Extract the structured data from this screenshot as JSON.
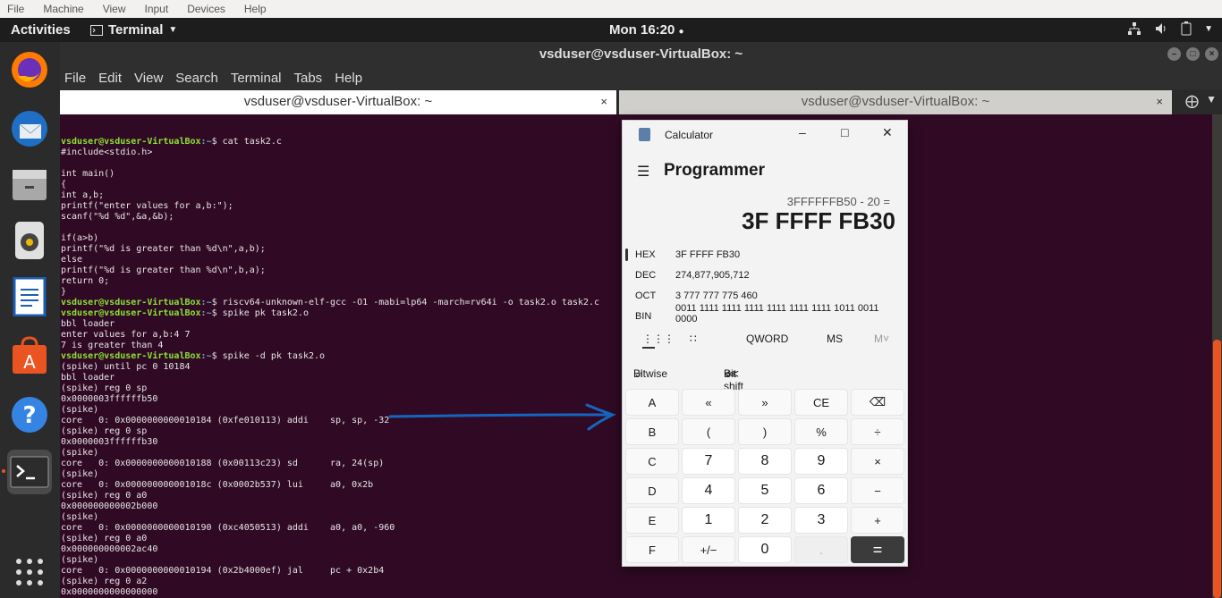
{
  "vbox_menu": [
    "File",
    "Machine",
    "View",
    "Input",
    "Devices",
    "Help"
  ],
  "topbar": {
    "activities": "Activities",
    "app_name": "Terminal",
    "clock": "Mon 16:20"
  },
  "terminal": {
    "window_title": "vsduser@vsduser-VirtualBox: ~",
    "menu": [
      "File",
      "Edit",
      "View",
      "Search",
      "Terminal",
      "Tabs",
      "Help"
    ],
    "tabs": [
      {
        "title": "vsduser@vsduser-VirtualBox: ~",
        "active": true
      },
      {
        "title": "vsduser@vsduser-VirtualBox: ~",
        "active": false
      }
    ],
    "prompt_user": "vsduser@vsduser-VirtualBox",
    "prompt_path": ":~",
    "lines": [
      {
        "prompt": true,
        "text": "$ cat task2.c"
      },
      {
        "prompt": false,
        "text": "#include<stdio.h>"
      },
      {
        "prompt": false,
        "text": ""
      },
      {
        "prompt": false,
        "text": "int main()"
      },
      {
        "prompt": false,
        "text": "{"
      },
      {
        "prompt": false,
        "text": "int a,b;"
      },
      {
        "prompt": false,
        "text": "printf(\"enter values for a,b:\");"
      },
      {
        "prompt": false,
        "text": "scanf(\"%d %d\",&a,&b);"
      },
      {
        "prompt": false,
        "text": ""
      },
      {
        "prompt": false,
        "text": "if(a>b)"
      },
      {
        "prompt": false,
        "text": "printf(\"%d is greater than %d\\n\",a,b);"
      },
      {
        "prompt": false,
        "text": "else"
      },
      {
        "prompt": false,
        "text": "printf(\"%d is greater than %d\\n\",b,a);"
      },
      {
        "prompt": false,
        "text": "return 0;"
      },
      {
        "prompt": false,
        "text": "}"
      },
      {
        "prompt": true,
        "text": "$ riscv64-unknown-elf-gcc -O1 -mabi=lp64 -march=rv64i -o task2.o task2.c"
      },
      {
        "prompt": true,
        "text": "$ spike pk task2.o"
      },
      {
        "prompt": false,
        "text": "bbl loader"
      },
      {
        "prompt": false,
        "text": "enter values for a,b:4 7"
      },
      {
        "prompt": false,
        "text": "7 is greater than 4"
      },
      {
        "prompt": true,
        "text": "$ spike -d pk task2.o"
      },
      {
        "prompt": false,
        "text": "(spike) until pc 0 10184"
      },
      {
        "prompt": false,
        "text": "bbl loader"
      },
      {
        "prompt": false,
        "text": "(spike) reg 0 sp"
      },
      {
        "prompt": false,
        "text": "0x0000003ffffffb50"
      },
      {
        "prompt": false,
        "text": "(spike)"
      },
      {
        "prompt": false,
        "text": "core   0: 0x0000000000010184 (0xfe010113) addi    sp, sp, -32"
      },
      {
        "prompt": false,
        "text": "(spike) reg 0 sp"
      },
      {
        "prompt": false,
        "text": "0x0000003ffffffb30"
      },
      {
        "prompt": false,
        "text": "(spike)"
      },
      {
        "prompt": false,
        "text": "core   0: 0x0000000000010188 (0x00113c23) sd      ra, 24(sp)"
      },
      {
        "prompt": false,
        "text": "(spike)"
      },
      {
        "prompt": false,
        "text": "core   0: 0x000000000001018c (0x0002b537) lui     a0, 0x2b"
      },
      {
        "prompt": false,
        "text": "(spike) reg 0 a0"
      },
      {
        "prompt": false,
        "text": "0x000000000002b000"
      },
      {
        "prompt": false,
        "text": "(spike)"
      },
      {
        "prompt": false,
        "text": "core   0: 0x0000000000010190 (0xc4050513) addi    a0, a0, -960"
      },
      {
        "prompt": false,
        "text": "(spike) reg 0 a0"
      },
      {
        "prompt": false,
        "text": "0x000000000002ac40"
      },
      {
        "prompt": false,
        "text": "(spike)"
      },
      {
        "prompt": false,
        "text": "core   0: 0x0000000000010194 (0x2b4000ef) jal     pc + 0x2b4"
      },
      {
        "prompt": false,
        "text": "(spike) reg 0 a2"
      },
      {
        "prompt": false,
        "text": "0x0000000000000000"
      }
    ]
  },
  "calculator": {
    "title": "Calculator",
    "mode": "Programmer",
    "expression": "3FFFFFFB50 - 20 =",
    "result": "3F FFFF FB30",
    "radix": [
      {
        "label": "HEX",
        "value": "3F FFFF FB30"
      },
      {
        "label": "DEC",
        "value": "274,877,905,712"
      },
      {
        "label": "OCT",
        "value": "3 777 777 775 460"
      },
      {
        "label": "BIN",
        "value": "0011 1111 1111 1111 1111 1111 1111 1011 0011 0000"
      }
    ],
    "word_size": "QWORD",
    "memory_store": "MS",
    "memory_menu": "M˅",
    "bitwise": "Bitwise",
    "bitshift": "Bit shift",
    "keys": [
      "A",
      "«",
      "»",
      "CE",
      "⌫",
      "B",
      "(",
      ")",
      "%",
      "÷",
      "C",
      "7",
      "8",
      "9",
      "×",
      "D",
      "4",
      "5",
      "6",
      "−",
      "E",
      "1",
      "2",
      "3",
      "+",
      "F",
      "+/−",
      "0",
      ".",
      "="
    ]
  },
  "colors": {
    "terminal_bg": "#300a24",
    "prompt_user": "#8ae234",
    "prompt_path": "#729fcf",
    "annotation_arrow": "#1565c0",
    "scroll_thumb": "#e95420"
  }
}
